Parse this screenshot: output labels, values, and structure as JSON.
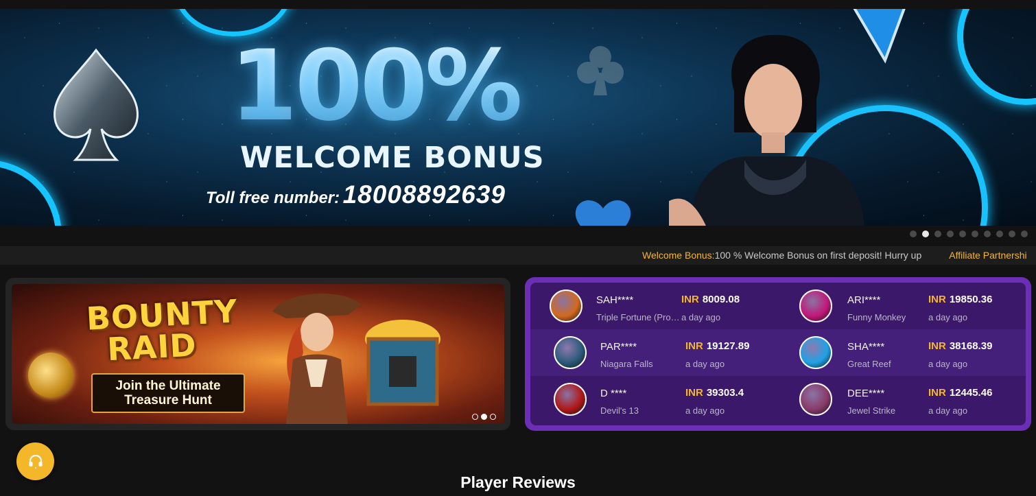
{
  "hero": {
    "headline": "100%",
    "subheadline": "WELCOME BONUS",
    "toll_label": "Toll free number:",
    "toll_number": "18008892639",
    "slide_count": 10,
    "active_slide": 2
  },
  "marquee": {
    "items": [
      {
        "key": "Welcome Bonus:",
        "value": "100 % Welcome Bonus on first deposit! Hurry up"
      },
      {
        "key": "Affiliate Partnershi",
        "value": ""
      }
    ]
  },
  "promo": {
    "title_line1": "BOUNTY",
    "title_line2": "RAID",
    "tagline_line1": "Join the Ultimate",
    "tagline_line2": "Treasure Hunt",
    "slide_count": 3,
    "active_slide": 2
  },
  "winners": [
    {
      "name": "SAH****",
      "game": "Triple Fortune (Prog...",
      "currency": "INR",
      "amount": "8009.08",
      "time": "a day ago",
      "avatar_color": "#d2691e"
    },
    {
      "name": "ARI****",
      "game": "Funny Monkey",
      "currency": "INR",
      "amount": "19850.36",
      "time": "a day ago",
      "avatar_color": "#c2187a"
    },
    {
      "name": "PAR****",
      "game": "Niagara Falls",
      "currency": "INR",
      "amount": "19127.89",
      "time": "a day ago",
      "avatar_color": "#2b5b7a"
    },
    {
      "name": "SHA****",
      "game": "Great Reef",
      "currency": "INR",
      "amount": "38168.39",
      "time": "a day ago",
      "avatar_color": "#1ea2e6"
    },
    {
      "name": "D ****",
      "game": "Devil's 13",
      "currency": "INR",
      "amount": "39303.4",
      "time": "a day ago",
      "avatar_color": "#b01818"
    },
    {
      "name": "DEE****",
      "game": "Jewel Strike",
      "currency": "INR",
      "amount": "12445.46",
      "time": "a day ago",
      "avatar_color": "#8a3a6a"
    }
  ],
  "reviews": {
    "title": "Player Reviews"
  },
  "icons": {
    "support": "headset-icon"
  },
  "colors": {
    "accent": "#f5b72a",
    "winners_border": "#6a2fb4",
    "winners_bg": "#3b1869"
  }
}
